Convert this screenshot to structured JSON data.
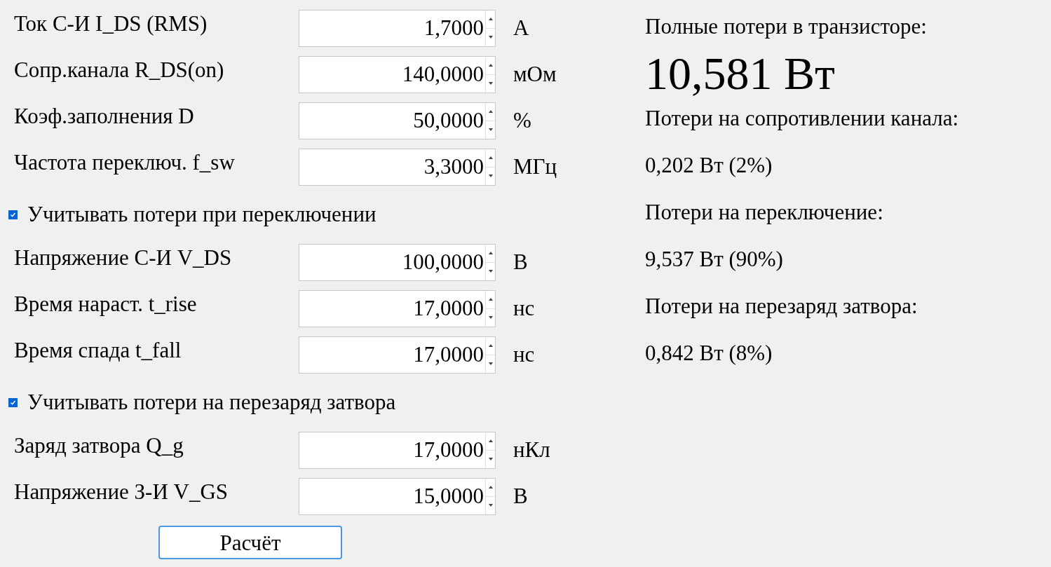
{
  "inputs": [
    {
      "kind": "field",
      "label": "Ток С-И I_DS (RMS)",
      "value": "1,7000",
      "unit": "А"
    },
    {
      "kind": "field",
      "label": "Сопр.канала R_DS(on)",
      "value": "140,0000",
      "unit": "мОм"
    },
    {
      "kind": "field",
      "label": "Коэф.заполнения  D",
      "value": "50,0000",
      "unit": "%"
    },
    {
      "kind": "field",
      "label": "Частота переключ. f_sw",
      "value": "3,3000",
      "unit": "МГц"
    },
    {
      "kind": "checkbox",
      "label": "Учитывать потери при переключении",
      "checked": true
    },
    {
      "kind": "field",
      "label": "Напряжение С-И V_DS",
      "value": "100,0000",
      "unit": "В"
    },
    {
      "kind": "field",
      "label": "Время нараст. t_rise",
      "value": "17,0000",
      "unit": "нс"
    },
    {
      "kind": "field",
      "label": "Время спада t_fall",
      "value": "17,0000",
      "unit": "нс"
    },
    {
      "kind": "checkbox",
      "label": "Учитывать потери на перезаряд затвора",
      "checked": true
    },
    {
      "kind": "field",
      "label": "Заряд затвора Q_g",
      "value": "17,0000",
      "unit": "нКл"
    },
    {
      "kind": "field",
      "label": "Напряжение З-И V_GS",
      "value": "15,0000",
      "unit": "В"
    }
  ],
  "calculate_button": "Расчёт",
  "results": [
    {
      "kind": "label",
      "text": "Полные потери в транзисторе:"
    },
    {
      "kind": "total",
      "text": "10,581 Вт"
    },
    {
      "kind": "label",
      "text": "Потери на сопротивлении канала:"
    },
    {
      "kind": "value",
      "text": "0,202 Вт (2%)"
    },
    {
      "kind": "label",
      "text": "Потери на переключение:"
    },
    {
      "kind": "value",
      "text": "9,537 Вт (90%)"
    },
    {
      "kind": "label",
      "text": "Потери на перезаряд затвора:"
    },
    {
      "kind": "value",
      "text": "0,842 Вт (8%)"
    }
  ]
}
